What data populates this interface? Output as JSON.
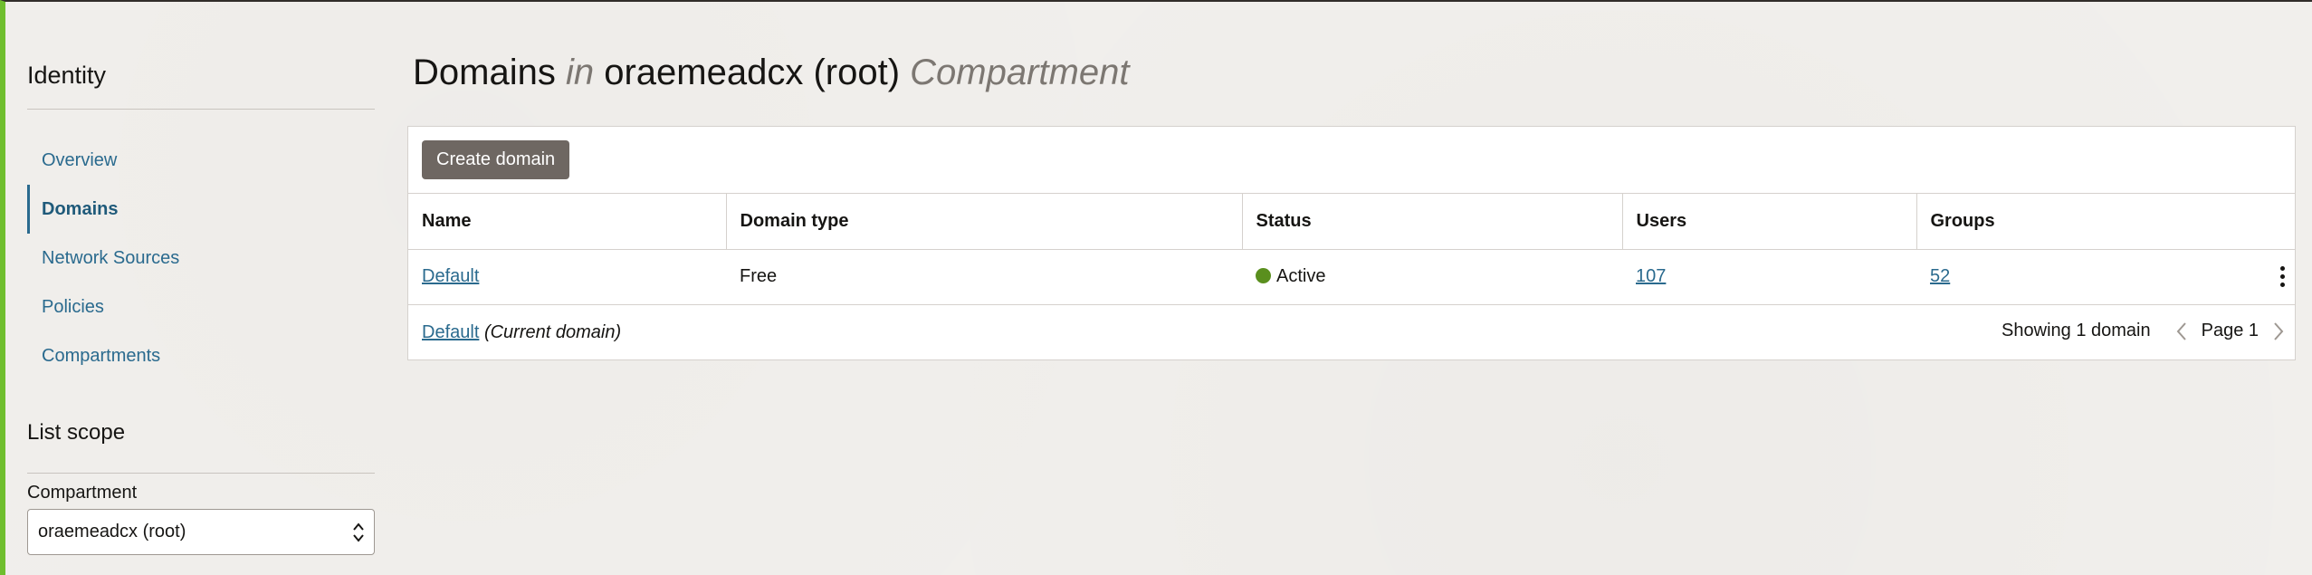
{
  "sidebar": {
    "title": "Identity",
    "nav": [
      {
        "label": "Overview",
        "active": false
      },
      {
        "label": "Domains",
        "active": true
      },
      {
        "label": "Network Sources",
        "active": false
      },
      {
        "label": "Policies",
        "active": false
      },
      {
        "label": "Compartments",
        "active": false
      }
    ],
    "scope_title": "List scope",
    "compartment_label": "Compartment",
    "compartment_value": "oraemeadcx (root)"
  },
  "main": {
    "heading": {
      "part1": "Domains",
      "part2": "in",
      "part3": "oraemeadcx (root)",
      "part4": "Compartment"
    },
    "create_button": "Create domain",
    "columns": [
      "Name",
      "Domain type",
      "Status",
      "Users",
      "Groups"
    ],
    "rows": [
      {
        "name": "Default",
        "domain_type": "Free",
        "status": "Active",
        "users": "107",
        "groups": "52"
      }
    ],
    "footer": {
      "current_link": "Default",
      "current_note": "(Current domain)",
      "showing": "Showing 1 domain",
      "page": "Page 1"
    }
  },
  "colors": {
    "accent_bar": "#6fbe2e",
    "link": "#2a6a8e",
    "status_active": "#5a8f1e",
    "button": "#6e6762"
  }
}
